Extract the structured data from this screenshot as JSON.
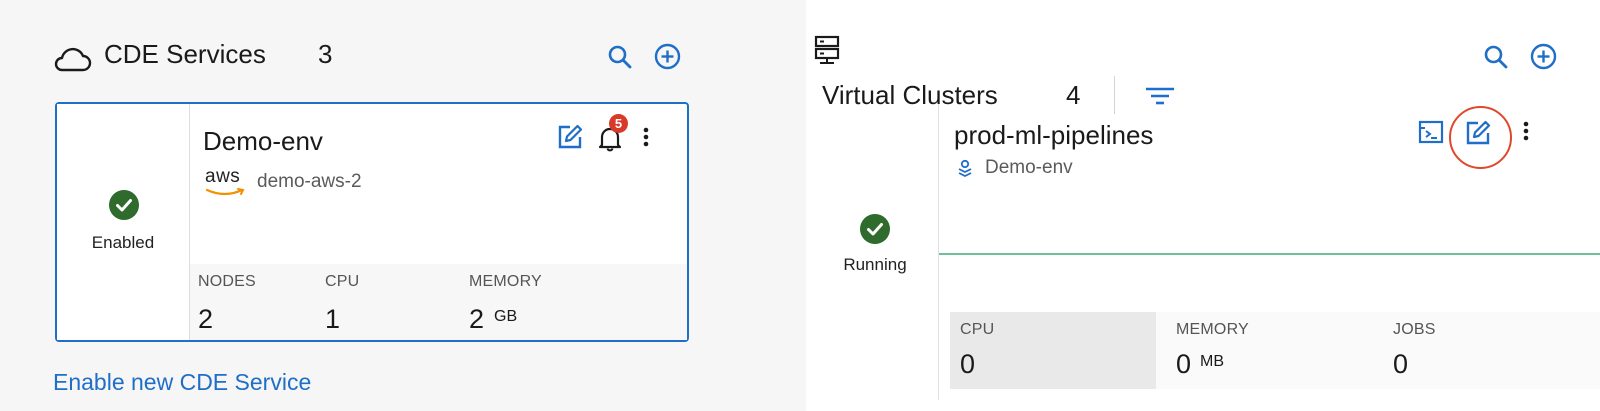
{
  "colors": {
    "accent": "#1f6ec7",
    "success": "#2e6b2c",
    "notification": "#d83a2a",
    "highlight": "#e0482c",
    "progress_line": "#6fbf9a"
  },
  "cde_services": {
    "title": "CDE Services",
    "count": "3",
    "icons": [
      "cloud-icon",
      "search-icon",
      "add-circle-icon"
    ],
    "card": {
      "name": "Demo-env",
      "provider_logo": "aws",
      "environment": "demo-aws-2",
      "status": "Enabled",
      "notifications": "5",
      "metrics": [
        {
          "label": "NODES",
          "value": "2",
          "unit": ""
        },
        {
          "label": "CPU",
          "value": "1",
          "unit": ""
        },
        {
          "label": "MEMORY",
          "value": "2",
          "unit": "GB"
        }
      ]
    },
    "enable_link": "Enable new CDE Service"
  },
  "virtual_clusters": {
    "title": "Virtual Clusters",
    "count": "4",
    "icons": [
      "server-icon",
      "search-icon",
      "add-circle-icon",
      "filter-icon"
    ],
    "card": {
      "name": "prod-ml-pipelines",
      "service": "Demo-env",
      "status": "Running",
      "metrics": [
        {
          "label": "CPU",
          "value": "0",
          "unit": ""
        },
        {
          "label": "MEMORY",
          "value": "0",
          "unit": "MB"
        },
        {
          "label": "JOBS",
          "value": "0",
          "unit": ""
        }
      ]
    }
  }
}
